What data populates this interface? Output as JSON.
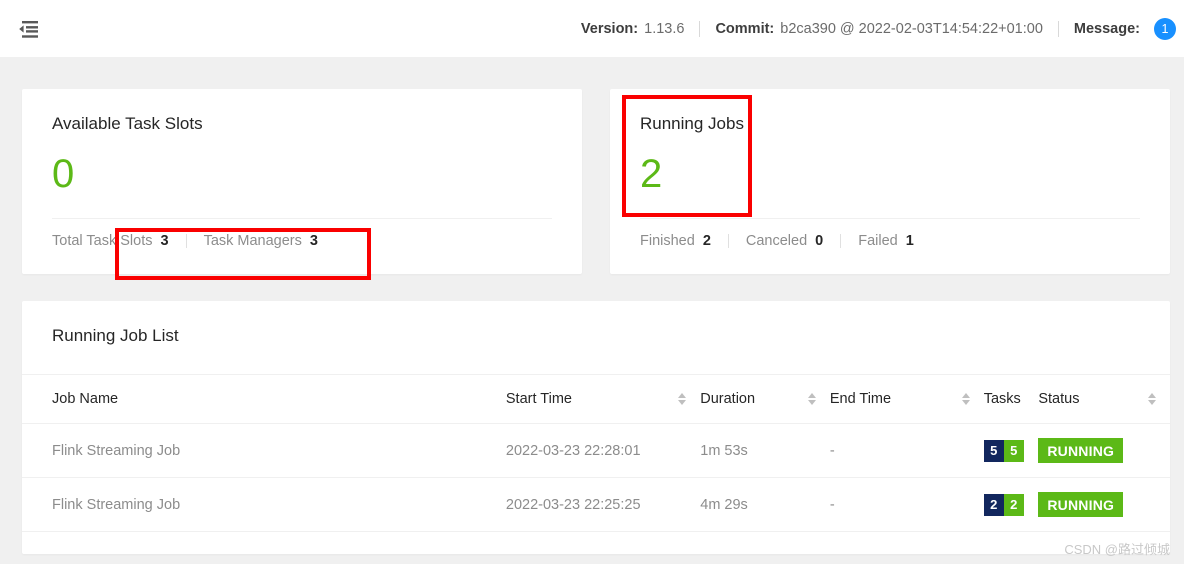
{
  "header": {
    "menu_icon": "menu-fold-icon",
    "version_label": "Version:",
    "version_value": "1.13.6",
    "commit_label": "Commit:",
    "commit_value": "b2ca390 @ 2022-02-03T14:54:22+01:00",
    "message_label": "Message:",
    "message_badge": "1",
    "badge_color": "#1890ff"
  },
  "cards": {
    "task_slots": {
      "title": "Available Task Slots",
      "value": "0",
      "value_color": "#5cb917",
      "footer": [
        {
          "label": "Total Task Slots",
          "value": "3"
        },
        {
          "label": "Task Managers",
          "value": "3"
        }
      ]
    },
    "running_jobs": {
      "title": "Running Jobs",
      "value": "2",
      "value_color": "#5cb917",
      "footer": [
        {
          "label": "Finished",
          "value": "2"
        },
        {
          "label": "Canceled",
          "value": "0"
        },
        {
          "label": "Failed",
          "value": "1"
        }
      ]
    }
  },
  "job_list": {
    "title": "Running Job List",
    "columns": [
      {
        "label": "Job Name",
        "sortable": false
      },
      {
        "label": "Start Time",
        "sortable": true
      },
      {
        "label": "Duration",
        "sortable": true
      },
      {
        "label": "End Time",
        "sortable": true
      },
      {
        "label": "Tasks",
        "sortable": false
      },
      {
        "label": "Status",
        "sortable": true
      }
    ],
    "rows": [
      {
        "job_name": "Flink Streaming Job",
        "start_time": "2022-03-23 22:28:01",
        "duration": "1m 53s",
        "end_time": "-",
        "tasks_navy": "5",
        "tasks_green": "5",
        "status": "RUNNING",
        "status_color": "#5cb917"
      },
      {
        "job_name": "Flink Streaming Job",
        "start_time": "2022-03-23 22:25:25",
        "duration": "4m 29s",
        "end_time": "-",
        "tasks_navy": "2",
        "tasks_green": "2",
        "status": "RUNNING",
        "status_color": "#5cb917"
      }
    ]
  },
  "annotations": {
    "color": "#fa0000",
    "boxes": [
      {
        "name": "total-task-slots-highlight"
      },
      {
        "name": "running-jobs-highlight"
      }
    ]
  },
  "watermark": "CSDN @路过倾城"
}
